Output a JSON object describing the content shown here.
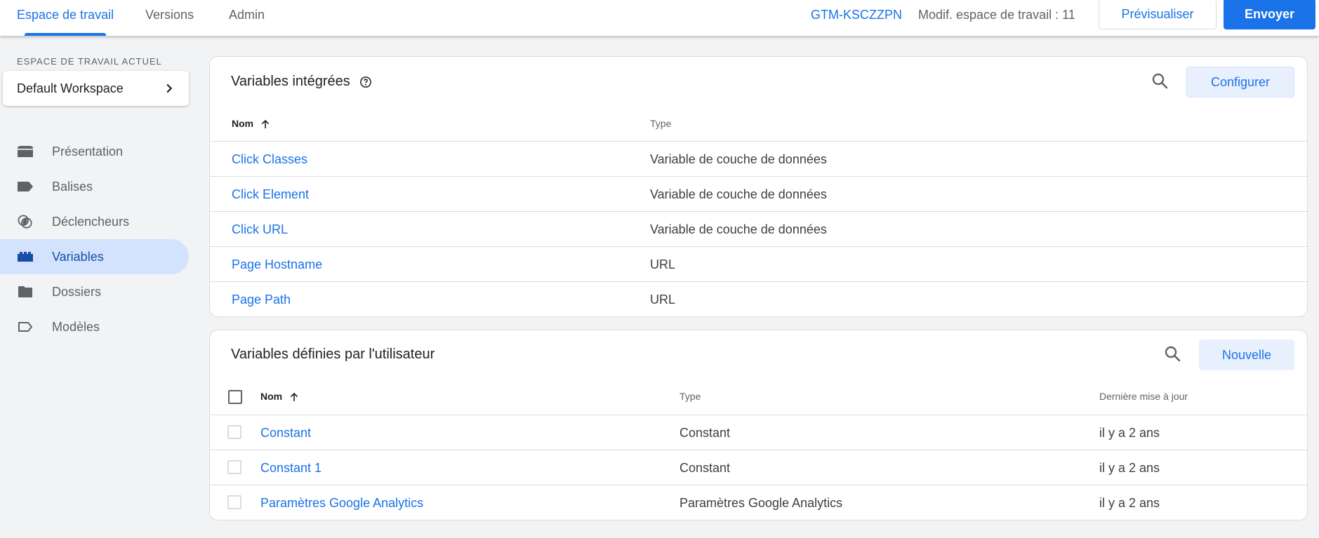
{
  "header": {
    "tabs": [
      {
        "label": "Espace de travail",
        "active": true
      },
      {
        "label": "Versions",
        "active": false
      },
      {
        "label": "Admin",
        "active": false
      }
    ],
    "container_id": "GTM-KSCZZPN",
    "workspace_changes": "Modif. espace de travail : 11",
    "preview_label": "Prévisualiser",
    "submit_label": "Envoyer"
  },
  "sidebar": {
    "workspace_section_label": "ESPACE DE TRAVAIL ACTUEL",
    "workspace_name": "Default Workspace",
    "items": [
      {
        "label": "Présentation",
        "icon": "overview-icon",
        "active": false
      },
      {
        "label": "Balises",
        "icon": "tag-icon",
        "active": false
      },
      {
        "label": "Déclencheurs",
        "icon": "trigger-icon",
        "active": false
      },
      {
        "label": "Variables",
        "icon": "variables-icon",
        "active": true
      },
      {
        "label": "Dossiers",
        "icon": "folder-icon",
        "active": false
      },
      {
        "label": "Modèles",
        "icon": "template-icon",
        "active": false
      }
    ]
  },
  "builtin": {
    "title": "Variables intégrées",
    "configure_label": "Configurer",
    "columns": {
      "name": "Nom",
      "type": "Type"
    },
    "rows": [
      {
        "name": "Click Classes",
        "type": "Variable de couche de données"
      },
      {
        "name": "Click Element",
        "type": "Variable de couche de données"
      },
      {
        "name": "Click URL",
        "type": "Variable de couche de données"
      },
      {
        "name": "Page Hostname",
        "type": "URL"
      },
      {
        "name": "Page Path",
        "type": "URL"
      }
    ]
  },
  "user_defined": {
    "title": "Variables définies par l'utilisateur",
    "new_label": "Nouvelle",
    "columns": {
      "name": "Nom",
      "type": "Type",
      "updated": "Dernière mise à jour"
    },
    "rows": [
      {
        "name": "Constant",
        "type": "Constant",
        "updated": "il y a 2 ans"
      },
      {
        "name": "Constant 1",
        "type": "Constant",
        "updated": "il y a 2 ans"
      },
      {
        "name": "Paramètres Google Analytics",
        "type": "Paramètres Google Analytics",
        "updated": "il y a 2 ans"
      }
    ]
  },
  "colors": {
    "accent": "#1a73e8",
    "active_nav_bg": "#d3e3fd",
    "active_nav_text": "#174ea6",
    "page_bg": "#f1f3f4"
  }
}
